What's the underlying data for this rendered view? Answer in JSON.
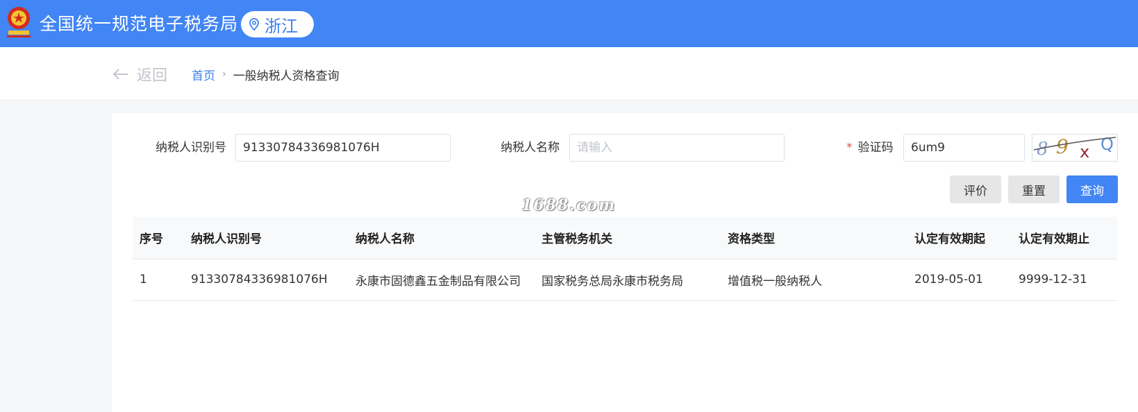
{
  "header": {
    "title": "全国统一规范电子税务局",
    "region": "浙江",
    "brand_color": "#4285f4"
  },
  "nav": {
    "back_label": "返回",
    "breadcrumb": [
      "首页",
      "一般纳税人资格查询"
    ]
  },
  "form": {
    "taxpayer_id": {
      "label": "纳税人识别号",
      "value": "91330784336981076H"
    },
    "taxpayer_name": {
      "label": "纳税人名称",
      "placeholder": "请输入",
      "value": ""
    },
    "captcha": {
      "label": "验证码",
      "required_mark": "*",
      "value": "6um9"
    },
    "buttons": {
      "evaluate": "评价",
      "reset": "重置",
      "query": "查询"
    }
  },
  "watermark": "1688.com",
  "table": {
    "columns": [
      "序号",
      "纳税人识别号",
      "纳税人名称",
      "主管税务机关",
      "资格类型",
      "认定有效期起",
      "认定有效期止"
    ],
    "rows": [
      [
        "1",
        "91330784336981076H",
        "永康市固德鑫五金制品有限公司",
        "国家税务总局永康市税务局",
        "增值税一般纳税人",
        "2019-05-01",
        "9999-12-31"
      ]
    ]
  }
}
